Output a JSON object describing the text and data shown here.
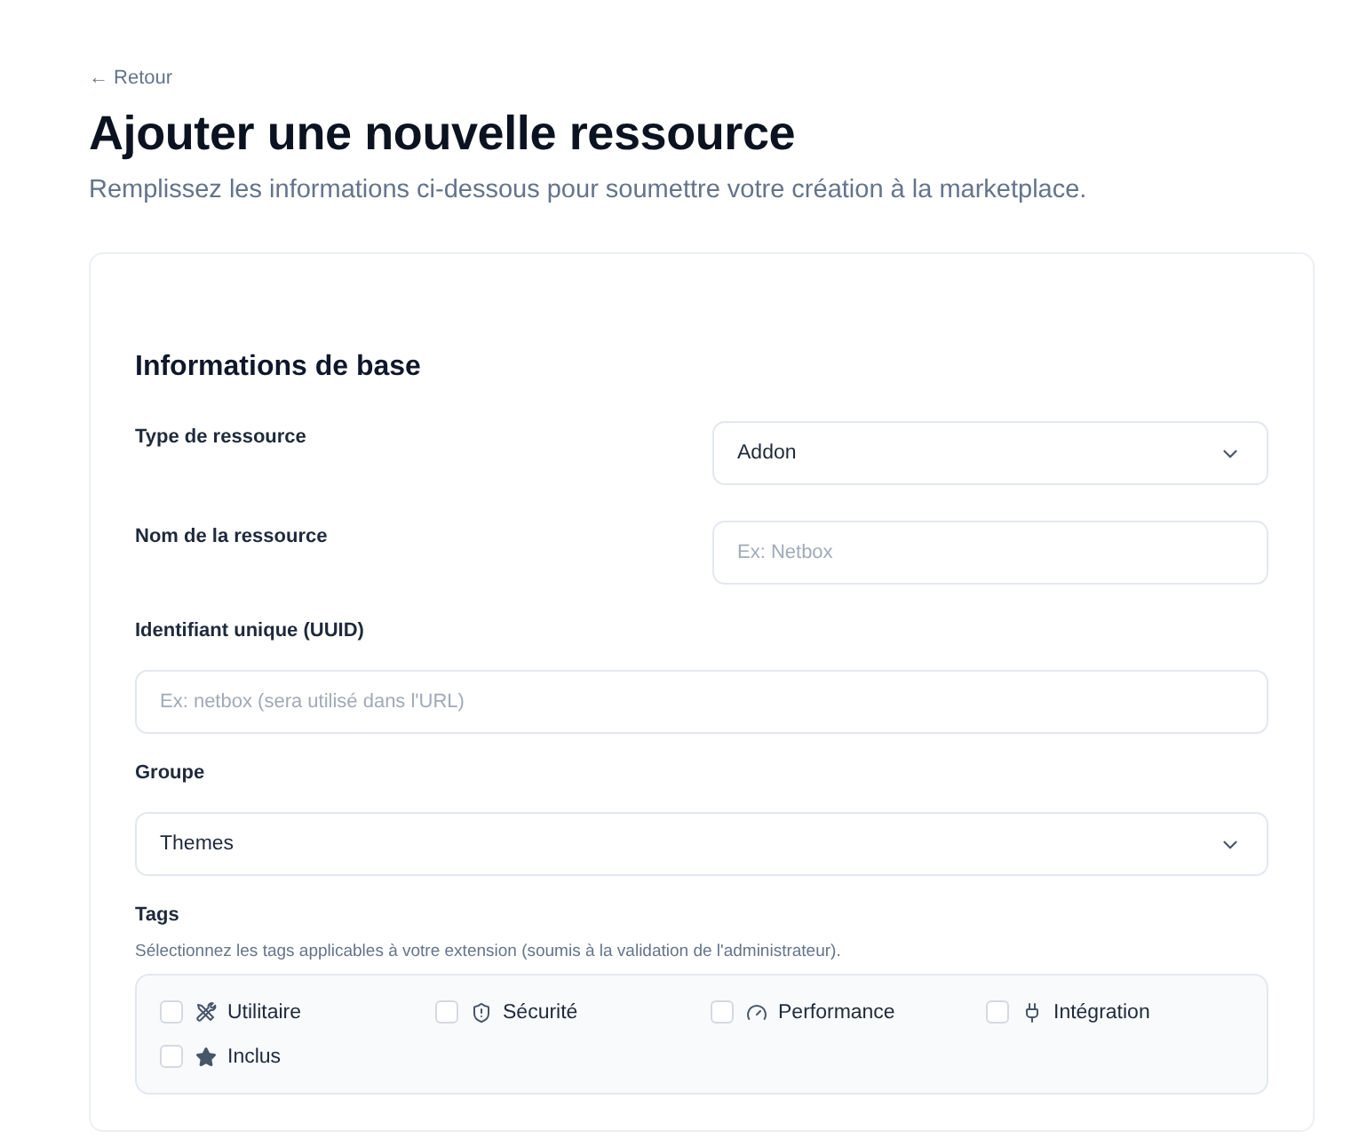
{
  "back_link": "← Retour",
  "title": "Ajouter une nouvelle ressource",
  "subtitle": "Remplissez les informations ci-dessous pour soumettre votre création à la marketplace.",
  "section": {
    "title": "Informations de base",
    "fields": [
      {
        "kind": "select",
        "inline": true,
        "label": "Type de ressource",
        "value": "Addon"
      },
      {
        "kind": "text",
        "inline": true,
        "label": "Nom de la ressource",
        "placeholder": "Ex: Netbox"
      },
      {
        "kind": "text",
        "inline": false,
        "label": "Identifiant unique (UUID)",
        "placeholder": "Ex: netbox (sera utilisé dans l'URL)"
      },
      {
        "kind": "select",
        "inline": false,
        "label": "Groupe",
        "value": "Themes"
      }
    ],
    "tags": {
      "label": "Tags",
      "hint": "Sélectionnez les tags applicables à votre extension (soumis à la validation de l'administrateur).",
      "options": [
        {
          "label": "Utilitaire",
          "checked": false
        },
        {
          "label": "Sécurité",
          "checked": false
        },
        {
          "label": "Performance",
          "checked": false
        },
        {
          "label": "Intégration",
          "checked": false
        },
        {
          "label": "Inclus",
          "checked": false
        }
      ]
    }
  }
}
